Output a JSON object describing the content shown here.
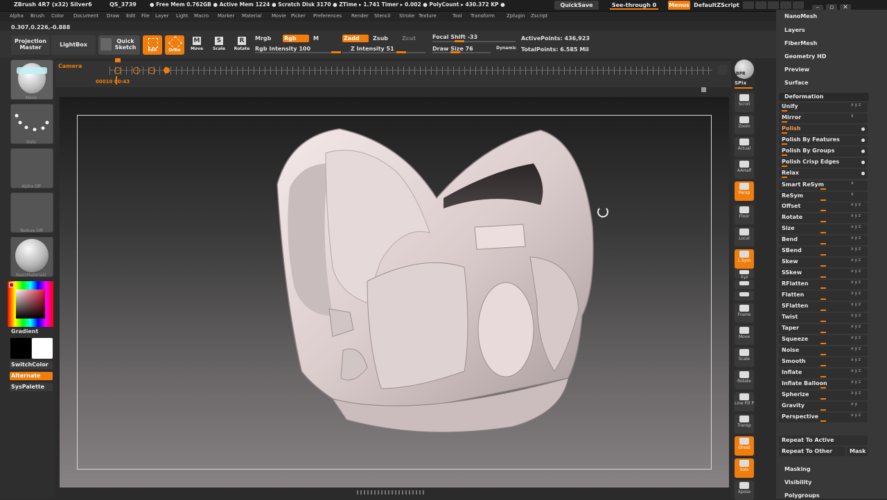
{
  "titlebar": {
    "app": "ZBrush 4R7 (x32) Silver6",
    "project": "QS_3739",
    "stats": "● Free Mem 0.762GB ● Active Mem 1224 ● Scratch Disk 3170 ● ZTime ▸ 1.741 Timer ▸ 0.002 ● PolyCount ▸ 430.372 KP ●",
    "quicksave": "QuickSave",
    "see_through": "See-through 0",
    "menus": "Menus",
    "script": "DefaultZScript"
  },
  "menubar": [
    "Alpha",
    "Brush",
    "Color",
    "Document",
    "Draw",
    "Edit",
    "File",
    "Layer",
    "Light",
    "Macro",
    "Marker",
    "Material",
    "Movie",
    "Picker",
    "Preferences",
    "Render",
    "Stencil",
    "Stroke",
    "Texture",
    "Tool",
    "Transform",
    "Zplugin",
    "Zscript"
  ],
  "coords": "0.307,0.226,-0.888",
  "toolbar": {
    "projection_master": "Projection Master",
    "lightbox": "LightBox",
    "quick_sketch": "Quick Sketch",
    "edit": "Edit",
    "draw": "Draw",
    "move": "Move",
    "scale": "Scale",
    "rotate": "Rotate",
    "mrgb": "Mrgb",
    "rgb": "Rgb",
    "m": "M",
    "rgb_intensity": "Rgb Intensity 100",
    "zadd": "Zadd",
    "zsub": "Zsub",
    "zcut": "Zcut",
    "z_intensity": "Z Intensity 51",
    "focal_shift": "Focal Shift -33",
    "draw_size": "Draw Size 76",
    "dynamic": "Dynamic",
    "active_points": "ActivePoints: 436,923",
    "total_points": "TotalPoints: 6.585 Mil"
  },
  "timeline": {
    "label": "Camera",
    "time": "00010 00:43"
  },
  "left_shelf": {
    "brush_label": "Move",
    "stroke_label": "Dots",
    "alpha_label": "Alpha Off",
    "texture_label": "Texture Off",
    "material_label": "BasicMaterial2",
    "gradient": "Gradient",
    "switch_color": "SwitchColor",
    "alternate": "Alternate",
    "syspalette": "SysPalette"
  },
  "right_shelf": {
    "bpr": "BPR",
    "spix": "SPix",
    "buttons": [
      "Scroll",
      "Zoom",
      "Actual",
      "AAHalf",
      "Persp",
      "Floor",
      "Local",
      "L.Sym",
      "Xyz",
      "",
      "",
      "Frame",
      "Move",
      "Scale",
      "Rotate",
      "Line Fill PolyF",
      "Transp",
      "Ghost",
      "Solo",
      "Xpose"
    ]
  },
  "panel": {
    "top_items": [
      "NanoMesh",
      "Layers",
      "FiberMesh",
      "Geometry HD",
      "Preview",
      "Surface"
    ],
    "section": "Deformation",
    "rows": [
      {
        "label": "Unify",
        "xyz": "x y z"
      },
      {
        "label": "Mirror",
        "xyz": "x"
      },
      {
        "label": "Polish",
        "xyz": "",
        "orange": true
      },
      {
        "label": "Polish By Features",
        "xyz": ""
      },
      {
        "label": "Polish By Groups",
        "xyz": ""
      },
      {
        "label": "Polish Crisp Edges",
        "xyz": ""
      },
      {
        "label": "Relax",
        "xyz": ""
      },
      {
        "label": "Smart ReSym",
        "xyz": "x"
      },
      {
        "label": "ReSym",
        "xyz": "x"
      },
      {
        "label": "Offset",
        "xyz": "x y z"
      },
      {
        "label": "Rotate",
        "xyz": "x y z"
      },
      {
        "label": "Size",
        "xyz": "x y z"
      },
      {
        "label": "Bend",
        "xyz": "x y z"
      },
      {
        "label": "SBend",
        "xyz": "x y z"
      },
      {
        "label": "Skew",
        "xyz": "x y z"
      },
      {
        "label": "SSkew",
        "xyz": "x y z"
      },
      {
        "label": "RFlatten",
        "xyz": "x y z"
      },
      {
        "label": "Flatten",
        "xyz": "x y z"
      },
      {
        "label": "SFlatten",
        "xyz": "x y z"
      },
      {
        "label": "Twist",
        "xyz": "x y z"
      },
      {
        "label": "Taper",
        "xyz": "x y z"
      },
      {
        "label": "Squeeze",
        "xyz": "x y z"
      },
      {
        "label": "Noise",
        "xyz": "x y z"
      },
      {
        "label": "Smooth",
        "xyz": "x y z"
      },
      {
        "label": "Inflate",
        "xyz": "x y z"
      },
      {
        "label": "Inflate Balloon",
        "xyz": "x y z"
      },
      {
        "label": "Spherize",
        "xyz": "x y z"
      },
      {
        "label": "Gravity",
        "xyz": "x y"
      },
      {
        "label": "Perspective",
        "xyz": "x y z"
      }
    ],
    "repeat_active": "Repeat To Active",
    "repeat_other": "Repeat To Other",
    "mask": "Mask",
    "bottom_items": [
      "Masking",
      "Visibility",
      "Polygroups"
    ]
  },
  "colors": {
    "accent": "#f07d0c",
    "panel": "#383838",
    "background": "#2b2b2b"
  }
}
